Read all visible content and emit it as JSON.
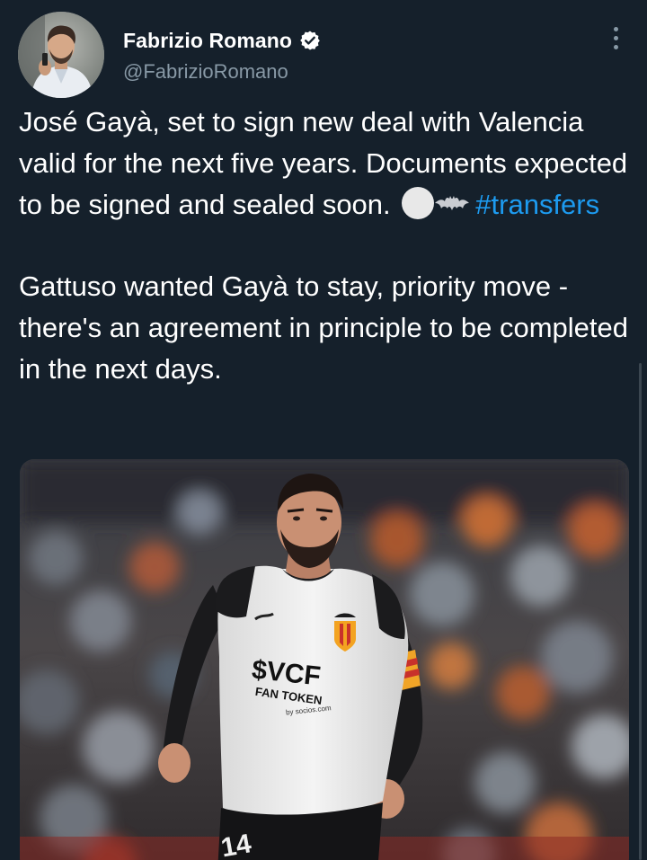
{
  "author": {
    "name": "Fabrizio Romano",
    "handle": "@FabrizioRomano",
    "verified": true
  },
  "tweet": {
    "line_1": "José Gayà, set to sign new deal with Valencia valid for the next five years. Documents expected to be signed and sealed soon.",
    "emojis": [
      "white-circle-icon",
      "bat-icon"
    ],
    "hashtag": "#transfers",
    "paragraph_2": "Gattuso wanted Gayà to stay, priority move - there's an agreement in principle to be completed in the next days."
  },
  "photo": {
    "jersey_sponsor": "$VCF",
    "jersey_sponsor_sub": "FAN TOKEN",
    "jersey_sponsor_by": "by socios.com",
    "shirt_number": "14"
  },
  "colors": {
    "background": "#15202b",
    "text": "#ffffff",
    "secondary_text": "#8899a6",
    "link": "#1d9bf0",
    "verified_badge": "#ffffff"
  }
}
